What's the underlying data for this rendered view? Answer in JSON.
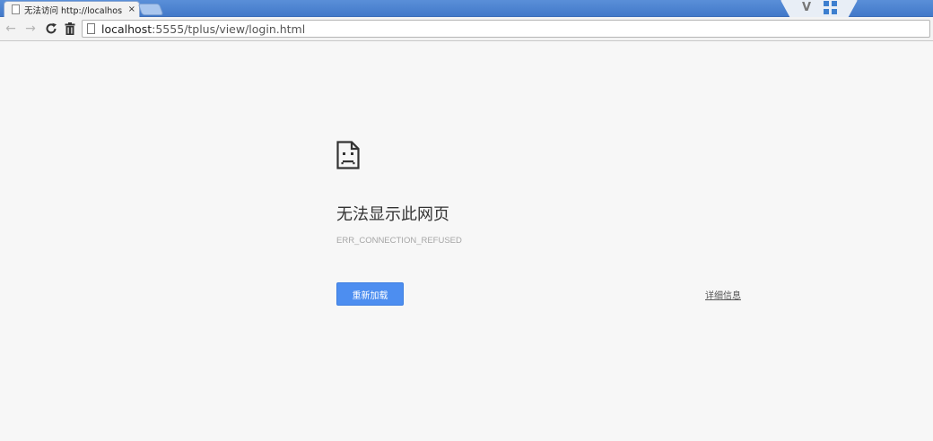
{
  "browser": {
    "tab": {
      "title": "无法访问 http://localhos",
      "close_glyph": "×"
    },
    "toolbar": {
      "back_glyph": "←",
      "forward_glyph": "→",
      "reload_glyph": "C",
      "trash_glyph": "🗑"
    },
    "omnibox": {
      "url_host": "localhost",
      "url_rest": ":5555/tplus/view/login.html"
    },
    "extensions": {
      "v_label": "V"
    }
  },
  "error_page": {
    "headline": "无法显示此网页",
    "error_code": "ERR_CONNECTION_REFUSED",
    "reload_button": "重新加载",
    "details_link": "详细信息"
  },
  "colors": {
    "accent_button": "#4d8ef0",
    "titlebar": "#4a82d0",
    "page_background": "#f7f7f7"
  },
  "icons": {
    "tab_page": "page-icon",
    "sad_page": "sad-page-icon",
    "extension_grid": "grid-extension-icon"
  }
}
